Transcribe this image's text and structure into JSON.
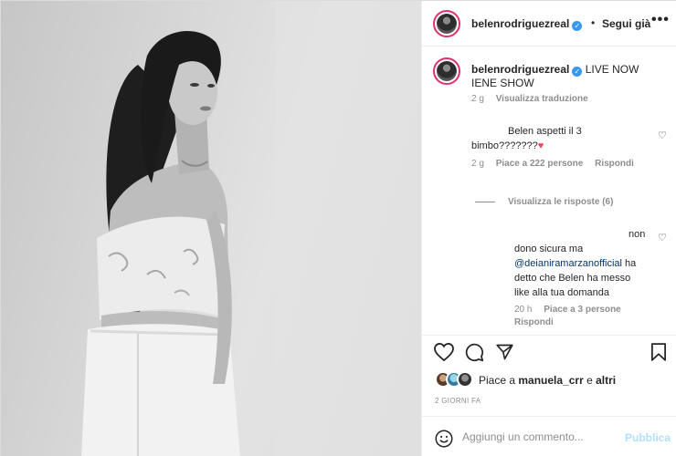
{
  "post": {
    "image_alt": "black and white photo of a woman with long dark hair",
    "header": {
      "username": "belenrodriguezreal",
      "verified_icon": "verified-badge-icon",
      "separator": "•",
      "follow_label": "Segui già",
      "more_label": "•••"
    },
    "caption": {
      "username": "belenrodriguezreal",
      "text": "LIVE NOW IENE SHOW",
      "time": "2 g",
      "translate_label": "Visualizza traduzione"
    },
    "comments": [
      {
        "text_line1": "Belen aspetti il 3",
        "text_line2": "bimbo???????",
        "emoji": "♥",
        "time": "2 g",
        "likes": "Piace a 222 persone",
        "reply_label": "Rispondi",
        "view_replies": "Visualizza le risposte (6)"
      },
      {
        "text_line1": "non",
        "text_line2": "dono sicura ma",
        "mention": "@deianiramarzanofficial",
        "text_line3": "ha",
        "text_line4": "detto che Belen ha messo",
        "text_line5": "like alla tua domanda",
        "time": "20 h",
        "likes": "Piace a 3 persone",
        "reply_label": "Rispondi"
      }
    ],
    "likes_summary": {
      "prefix": "Piace a",
      "user": "manuela_crr",
      "connector": "e",
      "others": "altri"
    },
    "date": "2 GIORNI FA",
    "add_comment": {
      "placeholder": "Aggiungi un commento...",
      "publish_label": "Pubblica"
    },
    "colors": {
      "verified": "#3897f0",
      "heart": "#ed4956",
      "publish_disabled": "#b2dffc",
      "mention": "#00376b"
    }
  }
}
